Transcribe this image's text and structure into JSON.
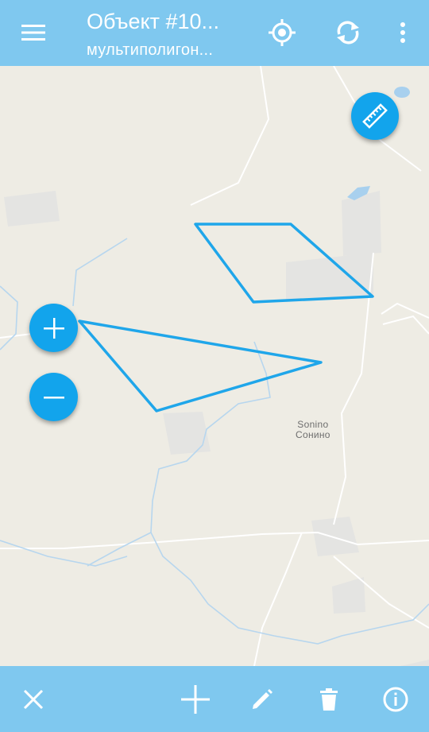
{
  "header": {
    "title": "Объект #10...",
    "subtitle": "мультиполигон..."
  },
  "map": {
    "places": [
      {
        "name_latin": "Sonino",
        "name_cyrillic": "Сонино"
      }
    ]
  },
  "colors": {
    "accent": "#12a4ec",
    "bar": "#7fc8ef",
    "polygon_stroke": "#1fa6ea",
    "map_background": "#eeece4"
  },
  "icons": {
    "menu": "menu-icon",
    "location": "my-location-icon",
    "sync": "sync-icon",
    "more": "more-vert-icon",
    "ruler": "ruler-icon",
    "zoom_in": "plus-icon",
    "zoom_out": "minus-icon",
    "close": "close-icon",
    "add": "add-icon",
    "edit": "pencil-icon",
    "delete": "trash-icon",
    "info": "info-icon"
  }
}
